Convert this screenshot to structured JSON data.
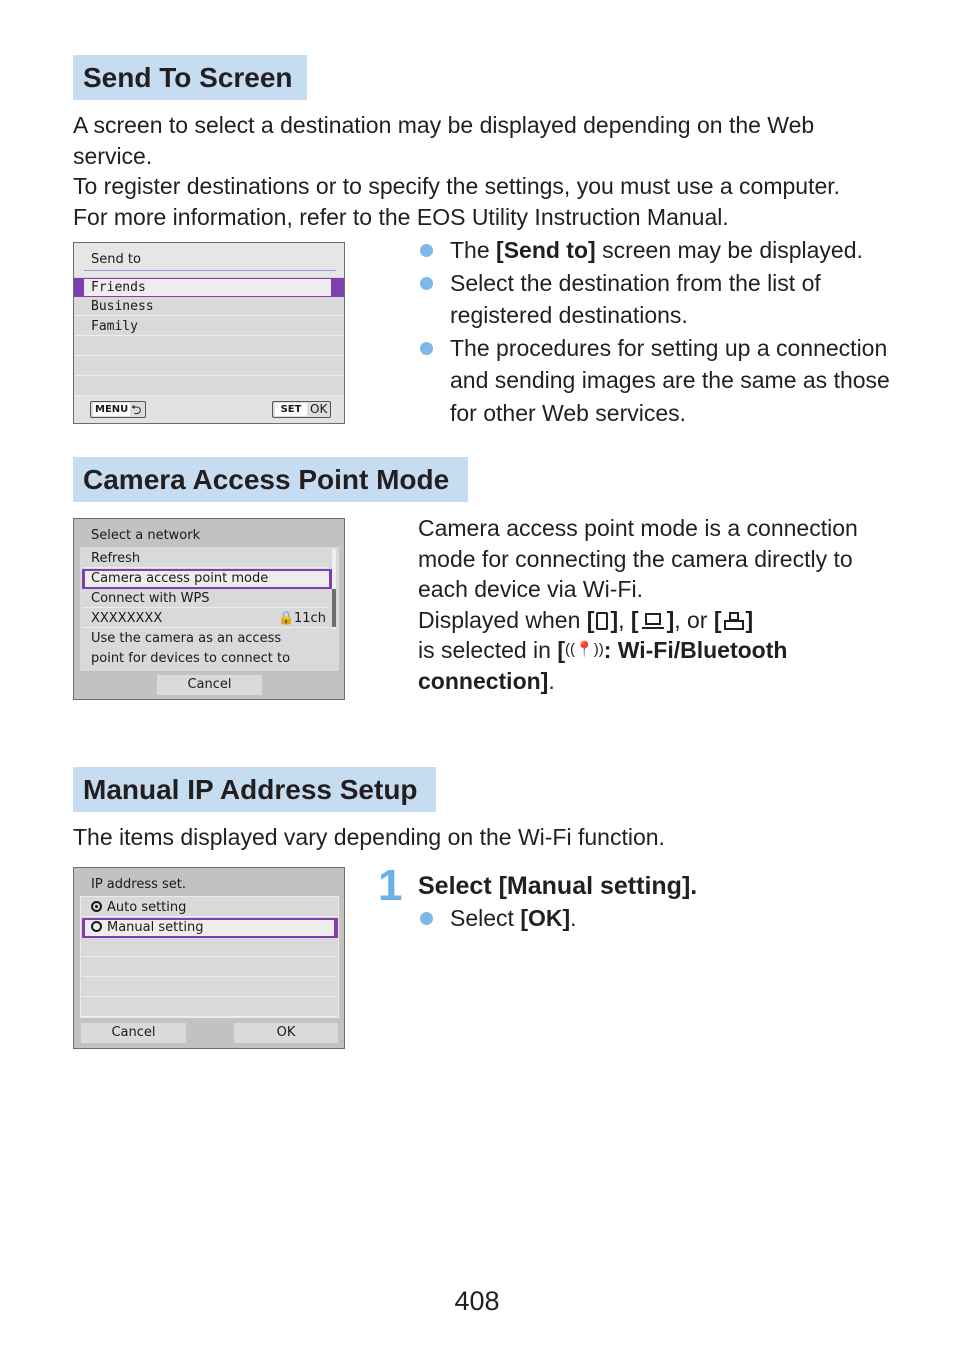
{
  "sections": {
    "send_to_screen": {
      "heading": "Send To Screen",
      "intro": [
        "A screen to select a destination may be displayed depending on the Web service.",
        "To register destinations or to specify the settings, you must use a computer.",
        "For more information, refer to the EOS Utility Instruction Manual."
      ],
      "screen": {
        "title": "Send to",
        "items": [
          "Friends",
          "Business",
          "Family"
        ],
        "selected_index": 0,
        "menu_button": "MENU",
        "set_button": "SET",
        "ok_label": "OK"
      },
      "bullets": [
        {
          "pre": "The ",
          "bold": "[Send to]",
          "post": " screen may be displayed."
        },
        {
          "pre": "Select the destination from the list of registered destinations.",
          "bold": "",
          "post": ""
        },
        {
          "pre": "The procedures for setting up a connection and sending images are the same as those for other Web services.",
          "bold": "",
          "post": ""
        }
      ]
    },
    "camera_access_point": {
      "heading": "Camera Access Point Mode",
      "screen": {
        "title": "Select a network",
        "items": [
          "Refresh",
          "Camera access point mode",
          "Connect with WPS",
          "XXXXXXXX"
        ],
        "network_channel": "11ch",
        "selected_index": 1,
        "description_line1": "Use the camera as an access",
        "description_line2": "point for devices to connect to",
        "cancel_button": "Cancel"
      },
      "text": {
        "line1": "Camera access point mode is a connection mode for connecting the camera directly to each device via Wi-Fi.",
        "displayed_when": "Displayed when ",
        "or": ", or ",
        "comma": ", ",
        "selected_in": "is selected in ",
        "menu_bold": ": Wi-Fi/Bluetooth connection]",
        "period": "."
      },
      "icons": [
        "smartphone-icon",
        "computer-icon",
        "printer-icon",
        "wireless-icon"
      ]
    },
    "manual_ip": {
      "heading": "Manual IP Address Setup",
      "intro": "The items displayed vary depending on the Wi-Fi function.",
      "screen": {
        "title": "IP address set.",
        "options": [
          "Auto setting",
          "Manual setting"
        ],
        "checked_index": 0,
        "highlighted_index": 1,
        "cancel_button": "Cancel",
        "ok_button": "OK"
      },
      "step": {
        "number": "1",
        "title": "Select [Manual setting].",
        "bullet_pre": "Select ",
        "bullet_bold": "[OK]",
        "bullet_post": "."
      }
    }
  },
  "colors": {
    "heading_bg": "#c6dcf1",
    "bullet": "#7db8e8",
    "highlight": "#7f3fb0",
    "step_number": "#6cb0e6"
  },
  "page_number": "408"
}
